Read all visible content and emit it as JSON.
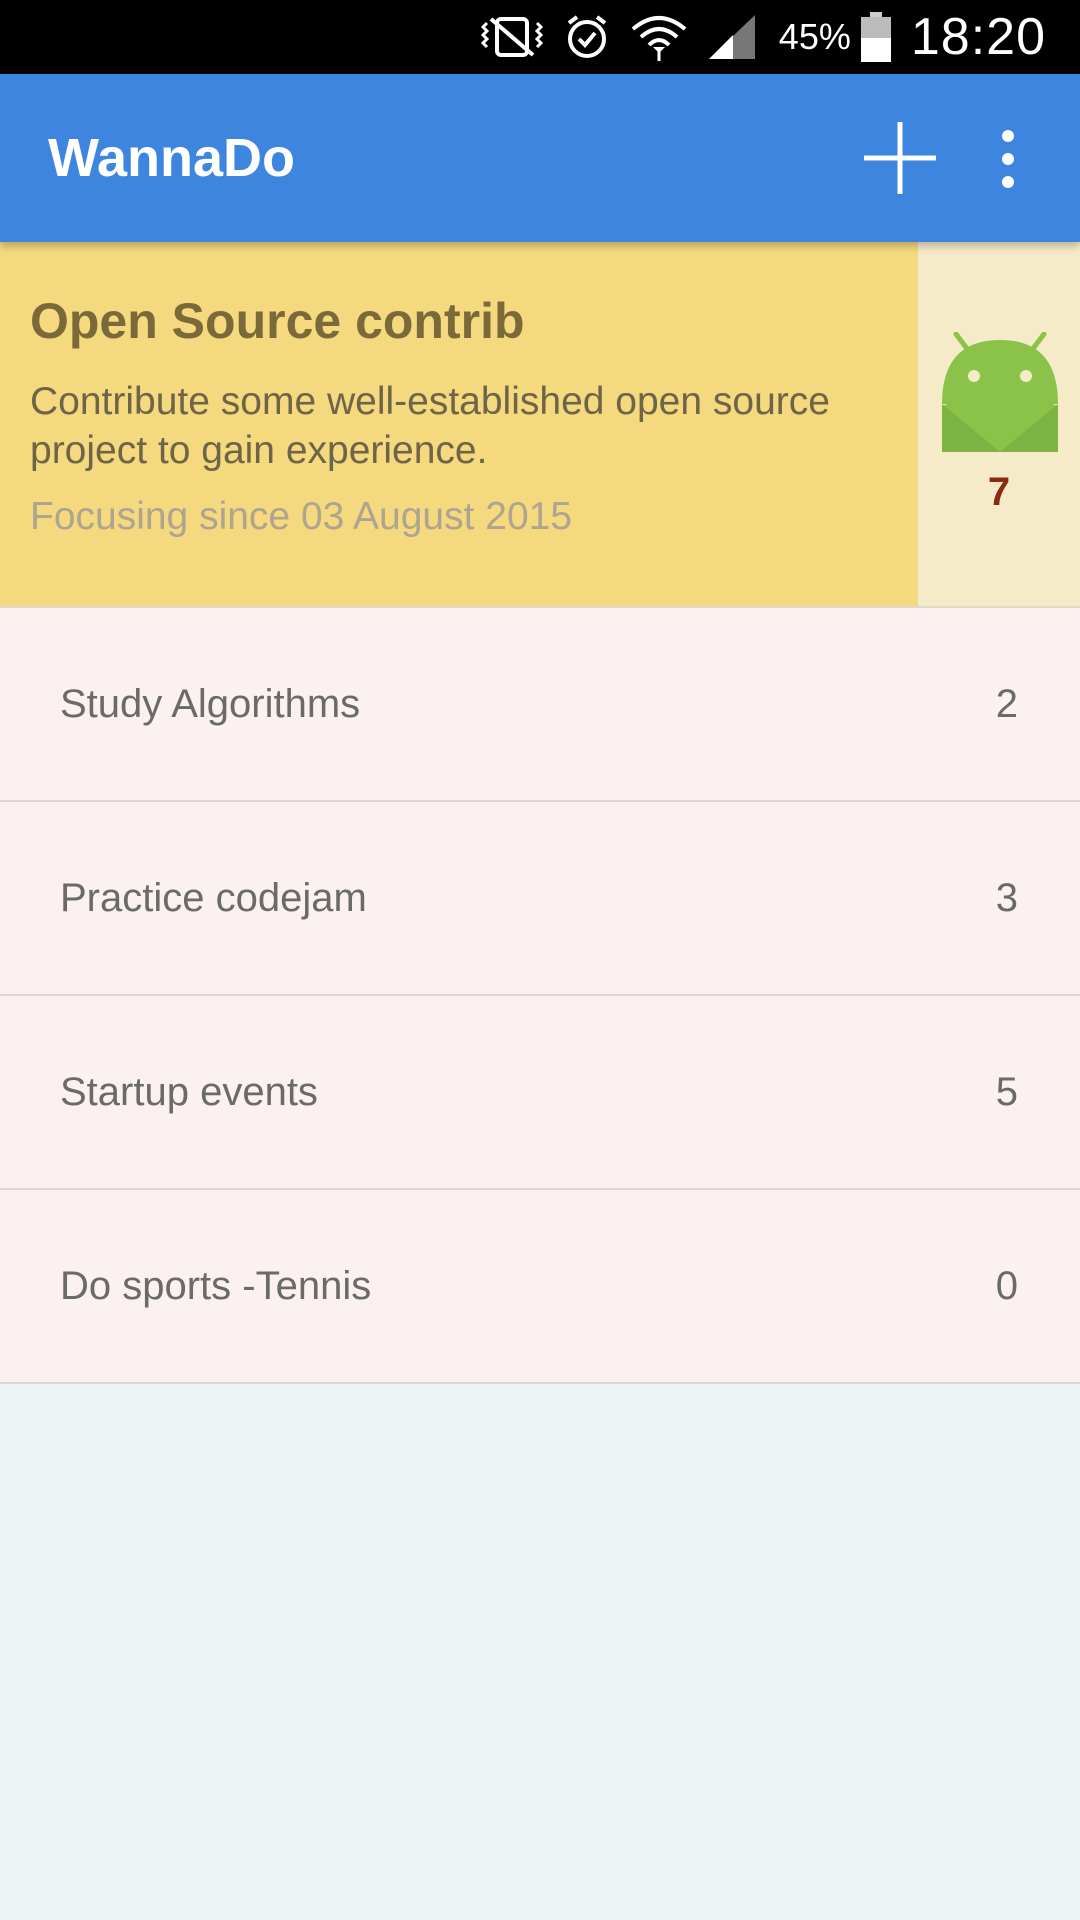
{
  "status_bar": {
    "battery_percent": "45%",
    "time": "18:20",
    "icons": [
      "vibrate-muted-icon",
      "alarm-icon",
      "wifi-icon",
      "signal-icon",
      "battery-icon"
    ]
  },
  "app_bar": {
    "title": "WannaDo",
    "actions": [
      "add-icon",
      "more-vert-icon"
    ]
  },
  "focus_card": {
    "title": "Open Source contrib",
    "description": "Contribute some well-established open source project to gain experience.",
    "since": "Focusing since 03 August 2015",
    "count": "7",
    "icon": "android-icon"
  },
  "goals": [
    {
      "name": "Study Algorithms",
      "count": "2"
    },
    {
      "name": "Practice codejam",
      "count": "3"
    },
    {
      "name": "Startup events",
      "count": "5"
    },
    {
      "name": "Do sports -Tennis",
      "count": "0"
    }
  ],
  "colors": {
    "app_bar": "#3D85DE",
    "focus_card": "#F4D97F",
    "focus_side": "#F6EBC9",
    "list_row": "#FBF1F0",
    "page_background": "#ECF5F3",
    "count_accent": "#8A2A10",
    "android_green": "#8BC34A"
  }
}
